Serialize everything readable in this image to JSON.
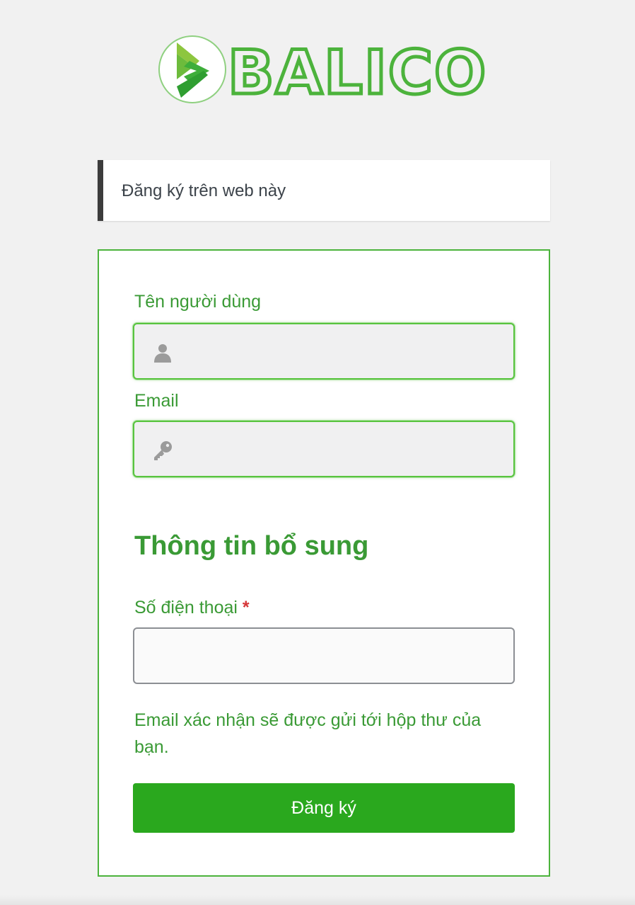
{
  "logo": {
    "text": "BALICO",
    "icon": "balico-chevron-logo-icon",
    "brand_color": "#4cb33c",
    "dark_color": "#2f9e31"
  },
  "notice": {
    "text": "Đăng ký trên web này"
  },
  "form": {
    "username": {
      "label": "Tên người dùng",
      "value": "",
      "icon": "user-icon"
    },
    "email": {
      "label": "Email",
      "value": "",
      "icon": "key-icon"
    },
    "section_title": "Thông tin bổ sung",
    "phone": {
      "label": "Số điện thoại",
      "required_mark": "*",
      "value": ""
    },
    "confirmation_note": "Email xác nhận sẽ được gửi tới hộp thư của bạn.",
    "submit_label": "Đăng ký"
  },
  "colors": {
    "label": "#3a9a35",
    "button": "#2aa81e",
    "border": "#4cb33c",
    "required": "#d63638"
  }
}
